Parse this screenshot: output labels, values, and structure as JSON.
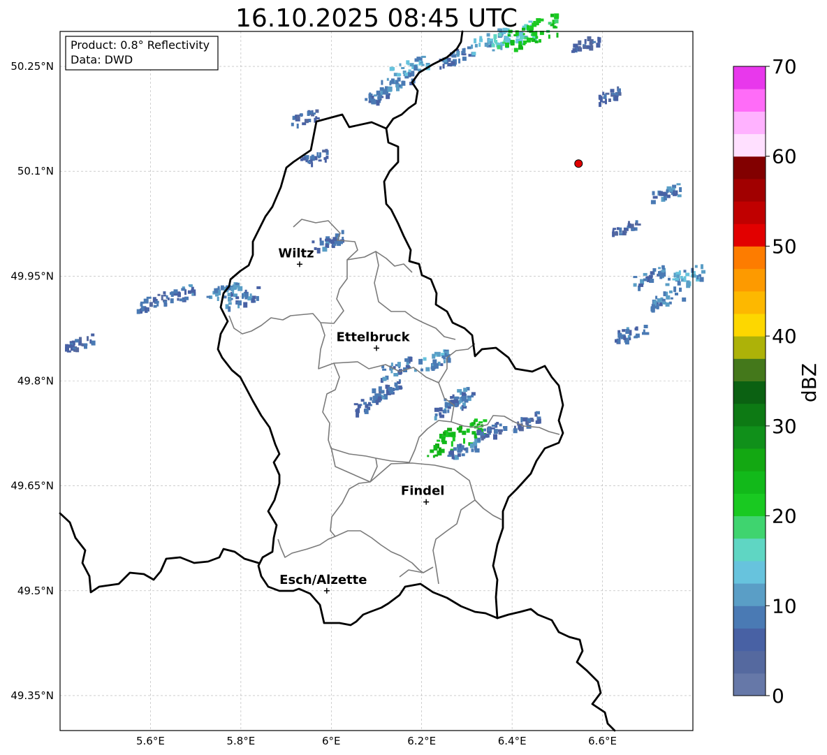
{
  "title": "16.10.2025 08:45 UTC",
  "info": {
    "product": "Product: 0.8° Reflectivity",
    "source": "Data: DWD"
  },
  "lat_ticks": [
    {
      "value": 50.25,
      "label": "50.25°N"
    },
    {
      "value": 50.1,
      "label": "50.1°N"
    },
    {
      "value": 49.95,
      "label": "49.95°N"
    },
    {
      "value": 49.8,
      "label": "49.8°N"
    },
    {
      "value": 49.65,
      "label": "49.65°N"
    },
    {
      "value": 49.5,
      "label": "49.5°N"
    },
    {
      "value": 49.35,
      "label": "49.35°N"
    }
  ],
  "lon_ticks": [
    {
      "value": 5.6,
      "label": "5.6°E"
    },
    {
      "value": 5.8,
      "label": "5.8°E"
    },
    {
      "value": 6.0,
      "label": "6°E"
    },
    {
      "value": 6.2,
      "label": "6.2°E"
    },
    {
      "value": 6.4,
      "label": "6.4°E"
    },
    {
      "value": 6.6,
      "label": "6.6°E"
    }
  ],
  "cities": [
    {
      "name": "Wiltz",
      "lon": 5.93,
      "lat": 49.967
    },
    {
      "name": "Ettelbruck",
      "lon": 6.1,
      "lat": 49.847
    },
    {
      "name": "Findel",
      "lon": 6.21,
      "lat": 49.627
    },
    {
      "name": "Esch/Alzette",
      "lon": 5.99,
      "lat": 49.5
    }
  ],
  "marker": {
    "lon": 6.547,
    "lat": 50.111,
    "color": "#e00000"
  },
  "colorbar": {
    "label": "dBZ",
    "min": 0,
    "max": 70,
    "step": 2.5,
    "tick_labels": [
      "0",
      "10",
      "20",
      "30",
      "40",
      "50",
      "60",
      "70"
    ],
    "colors": [
      "#6678a8",
      "#55699f",
      "#4861a4",
      "#4a7ab4",
      "#5a9ec6",
      "#67c3dd",
      "#5fd6c3",
      "#3fd46f",
      "#19c921",
      "#12b91a",
      "#13a812",
      "#10901a",
      "#0d7a14",
      "#0b6112",
      "#44781b",
      "#adb208",
      "#fdd700",
      "#fdb800",
      "#fd9a00",
      "#fd7c00",
      "#e20000",
      "#c00000",
      "#a10000",
      "#820000",
      "#ffe0ff",
      "#ffb2ff",
      "#ff6cf8",
      "#e838ec"
    ]
  },
  "radar": {
    "legend_ref": "dBZ",
    "cells": [
      {
        "lon": 6.1,
        "lat": 50.21,
        "dbz": 8
      },
      {
        "lon": 6.14,
        "lat": 50.23,
        "dbz": 10
      },
      {
        "lon": 6.17,
        "lat": 50.25,
        "dbz": 12
      },
      {
        "lon": 6.27,
        "lat": 50.265,
        "dbz": 8
      },
      {
        "lon": 6.35,
        "lat": 50.29,
        "dbz": 12
      },
      {
        "lon": 6.4,
        "lat": 50.295,
        "dbz": 15
      },
      {
        "lon": 6.44,
        "lat": 50.3,
        "dbz": 22
      },
      {
        "lon": 5.94,
        "lat": 50.178,
        "dbz": 6
      },
      {
        "lon": 5.96,
        "lat": 50.12,
        "dbz": 6
      },
      {
        "lon": 5.99,
        "lat": 50.0,
        "dbz": 8
      },
      {
        "lon": 5.6,
        "lat": 49.915,
        "dbz": 7
      },
      {
        "lon": 5.66,
        "lat": 49.925,
        "dbz": 8
      },
      {
        "lon": 5.76,
        "lat": 49.93,
        "dbz": 10
      },
      {
        "lon": 5.8,
        "lat": 49.92,
        "dbz": 9
      },
      {
        "lon": 5.44,
        "lat": 49.855,
        "dbz": 6
      },
      {
        "lon": 6.14,
        "lat": 49.82,
        "dbz": 8
      },
      {
        "lon": 6.22,
        "lat": 49.83,
        "dbz": 10
      },
      {
        "lon": 6.28,
        "lat": 49.78,
        "dbz": 9
      },
      {
        "lon": 6.26,
        "lat": 49.765,
        "dbz": 8
      },
      {
        "lon": 6.12,
        "lat": 49.79,
        "dbz": 7
      },
      {
        "lon": 6.08,
        "lat": 49.77,
        "dbz": 8
      },
      {
        "lon": 6.27,
        "lat": 49.72,
        "dbz": 24
      },
      {
        "lon": 6.29,
        "lat": 49.705,
        "dbz": 8
      },
      {
        "lon": 6.35,
        "lat": 49.73,
        "dbz": 7
      },
      {
        "lon": 6.43,
        "lat": 49.745,
        "dbz": 6
      },
      {
        "lon": 6.7,
        "lat": 49.95,
        "dbz": 9
      },
      {
        "lon": 6.74,
        "lat": 49.92,
        "dbz": 10
      },
      {
        "lon": 6.66,
        "lat": 49.87,
        "dbz": 8
      },
      {
        "lon": 6.78,
        "lat": 49.95,
        "dbz": 12
      },
      {
        "lon": 6.74,
        "lat": 50.07,
        "dbz": 8
      },
      {
        "lon": 6.65,
        "lat": 50.02,
        "dbz": 6
      },
      {
        "lon": 6.61,
        "lat": 50.21,
        "dbz": 6
      },
      {
        "lon": 6.56,
        "lat": 50.285,
        "dbz": 6
      }
    ]
  }
}
